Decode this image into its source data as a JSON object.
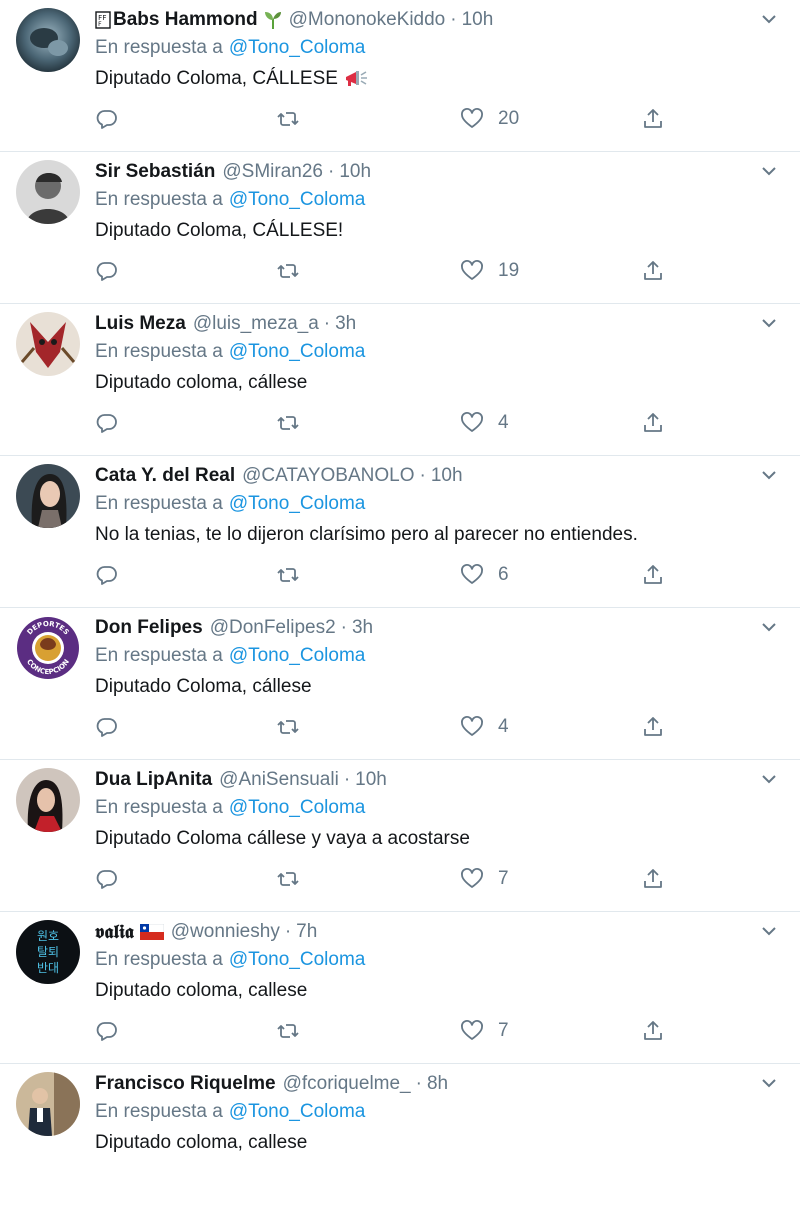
{
  "colors": {
    "accent": "#1b95e0",
    "muted": "#657786",
    "text": "#14171a",
    "divider": "#e1e8ed"
  },
  "tweets": [
    {
      "name": "Babs Hammond",
      "name_prefix": "🄵",
      "emoji": "seedling-icon",
      "handle": "@MononokeKiddo",
      "time": "10h",
      "reply_label": "En respuesta a",
      "mention": "@Tono_Coloma",
      "text": "Diputado Coloma, CÁLLESE",
      "text_emoji": "megaphone-icon",
      "likes": "20"
    },
    {
      "name": "Sir Sebastián",
      "handle": "@SMiran26",
      "time": "10h",
      "reply_label": "En respuesta a",
      "mention": "@Tono_Coloma",
      "text": "Diputado Coloma, CÁLLESE!",
      "likes": "19"
    },
    {
      "name": "Luis Meza",
      "handle": "@luis_meza_a",
      "time": "3h",
      "reply_label": "En respuesta a",
      "mention": "@Tono_Coloma",
      "text": "Diputado coloma, cállese",
      "likes": "4"
    },
    {
      "name": "Cata Y. del Real",
      "handle": "@CATAYOBANOLO",
      "time": "10h",
      "reply_label": "En respuesta a",
      "mention": "@Tono_Coloma",
      "text": "No la tenias, te lo dijeron clarísimo pero al parecer no entiendes.",
      "likes": "6"
    },
    {
      "name": "Don Felipes",
      "handle": "@DonFelipes2",
      "time": "3h",
      "reply_label": "En respuesta a",
      "mention": "@Tono_Coloma",
      "text": "Diputado Coloma, cállese",
      "likes": "4",
      "avatar_text_top": "DEPORTES",
      "avatar_text_bottom": "CONCEPCION"
    },
    {
      "name": "Dua LipAnita",
      "handle": "@AniSensuali",
      "time": "10h",
      "reply_label": "En respuesta a",
      "mention": "@Tono_Coloma",
      "text": "Diputado Coloma cállese y vaya a acostarse",
      "likes": "7"
    },
    {
      "name": "𝖛𝖆𝖑𝖎𝖆",
      "emoji": "chile-flag-icon",
      "handle": "@wonnieshy",
      "time": "7h",
      "reply_label": "En respuesta a",
      "mention": "@Tono_Coloma",
      "text": "Diputado coloma, callese",
      "likes": "7",
      "avatar_lines": [
        "원호",
        "탈퇴",
        "반대"
      ]
    },
    {
      "name": "Francisco Riquelme",
      "handle": "@fcoriquelme_",
      "time": "8h",
      "reply_label": "En respuesta a",
      "mention": "@Tono_Coloma",
      "text": "Diputado coloma, callese",
      "likes": ""
    }
  ]
}
